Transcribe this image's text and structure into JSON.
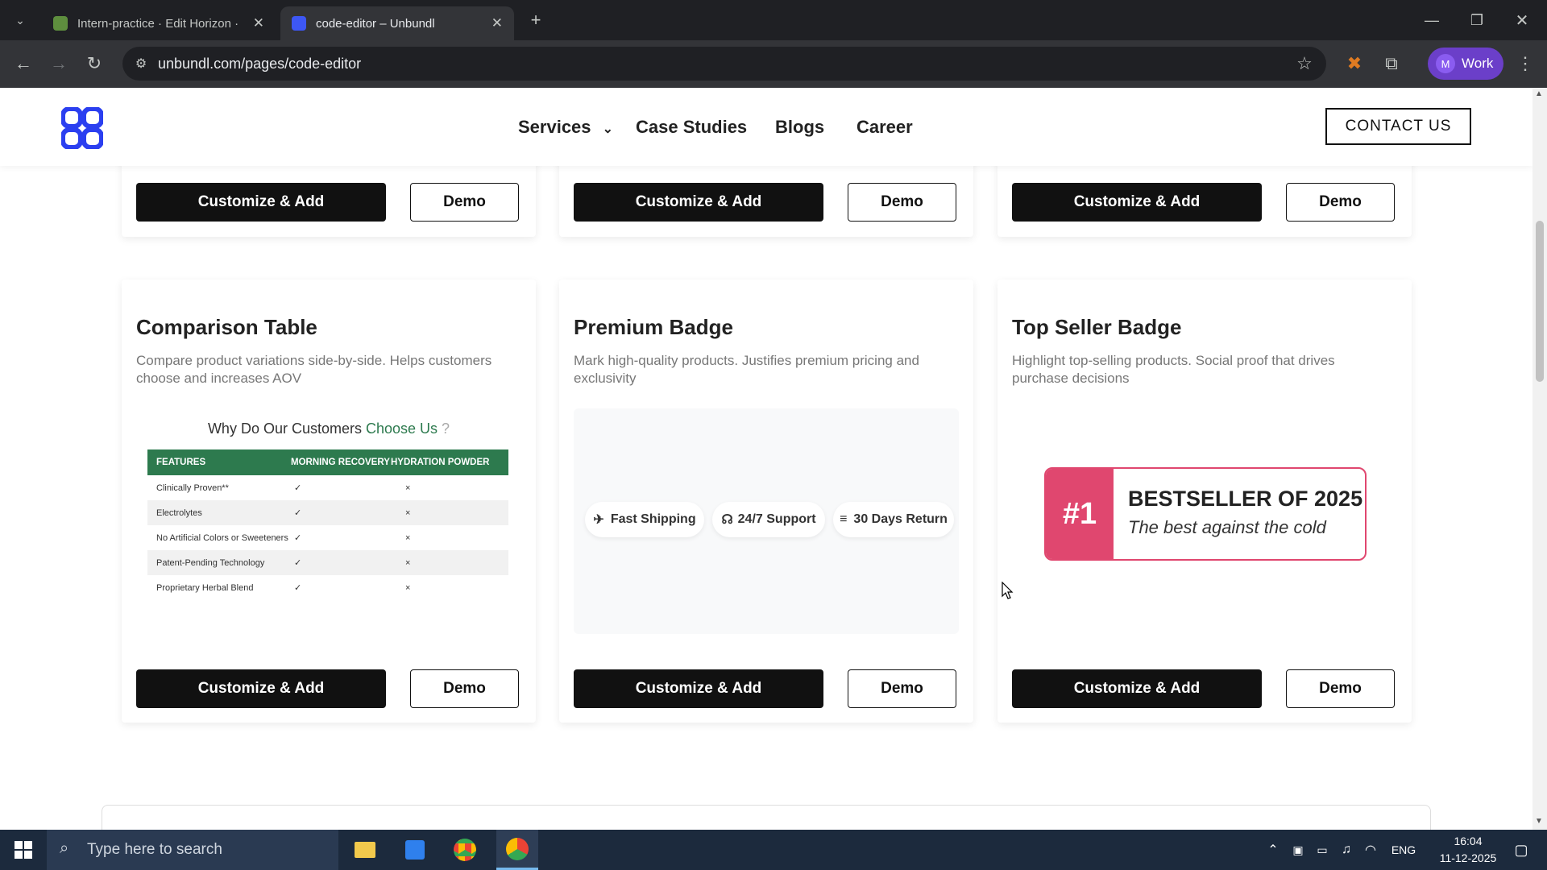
{
  "browser": {
    "tabs": [
      {
        "title": "Intern-practice · Edit Horizon · S",
        "active": false
      },
      {
        "title": "code-editor – Unbundl",
        "active": true
      }
    ],
    "url": "unbundl.com/pages/code-editor",
    "profile": "Work",
    "profile_initial": "M"
  },
  "site": {
    "nav": [
      "Services",
      "Case Studies",
      "Blogs",
      "Career"
    ],
    "contact_label": "CONTACT US"
  },
  "buttons": {
    "customize": "Customize & Add",
    "demo": "Demo"
  },
  "cards": [
    {
      "title": "Comparison Table",
      "description": "Compare product variations side-by-side. Helps customers choose and increases AOV",
      "table": {
        "heading_prefix": "Why Do Our Customers ",
        "heading_highlight": "Choose Us",
        "heading_suffix": " ?",
        "headers": [
          "FEATURES",
          "MORNING RECOVERY",
          "HYDRATION POWDER"
        ],
        "rows": [
          [
            "Clinically Proven**",
            "✓",
            "×"
          ],
          [
            "Electrolytes",
            "✓",
            "×"
          ],
          [
            "No Artificial Colors or Sweeteners",
            "✓",
            "×"
          ],
          [
            "Patent-Pending Technology",
            "✓",
            "×"
          ],
          [
            "Proprietary Herbal Blend",
            "✓",
            "×"
          ]
        ]
      }
    },
    {
      "title": "Premium Badge",
      "description": "Mark high-quality products. Justifies premium pricing and exclusivity",
      "pills": [
        "Fast Shipping",
        "24/7 Support",
        "30 Days Return"
      ]
    },
    {
      "title": "Top Seller Badge",
      "description": "Highlight top-selling products. Social proof that drives purchase decisions",
      "badge": {
        "number": "#1",
        "headline": "BESTSELLER OF 2025",
        "subline": "The best against the cold"
      }
    }
  ],
  "taskbar": {
    "search_placeholder": "Type here to search",
    "lang": "ENG",
    "time": "16:04",
    "date": "11-12-2025"
  },
  "colors": {
    "accent_green": "#2d7a4e",
    "badge_pink": "#e0476f",
    "brand_blue": "#2b3ff0"
  }
}
